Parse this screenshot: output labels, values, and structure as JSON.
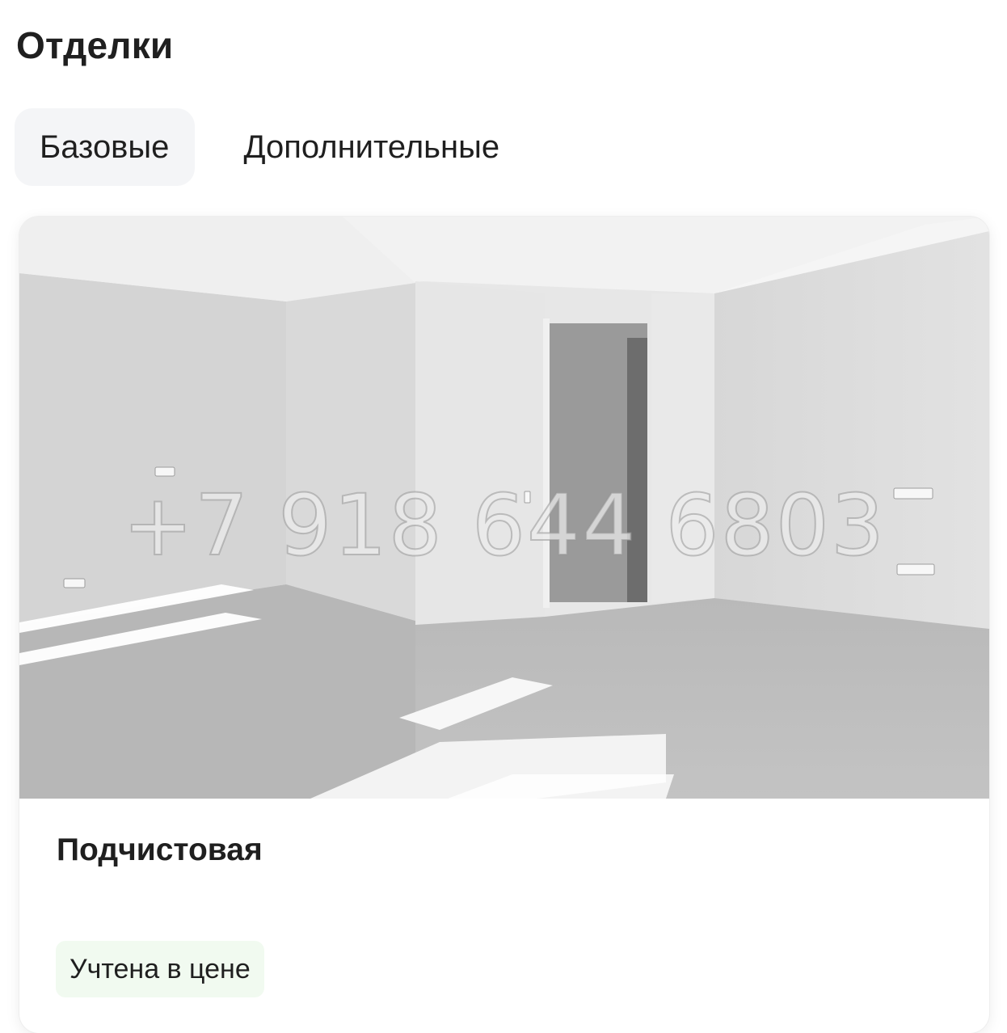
{
  "section": {
    "title": "Отделки"
  },
  "tabs": [
    {
      "label": "Базовые",
      "active": true
    },
    {
      "label": "Дополнительные",
      "active": false
    }
  ],
  "card": {
    "image_icon": "room-photo",
    "watermark": "+7 918 644 6803",
    "title": "Подчистовая",
    "badge": "Учтена в цене",
    "badge_color": "#f1faf0"
  },
  "colors": {
    "text": "#1f1f1f",
    "active_tab_bg": "#f4f5f7"
  }
}
